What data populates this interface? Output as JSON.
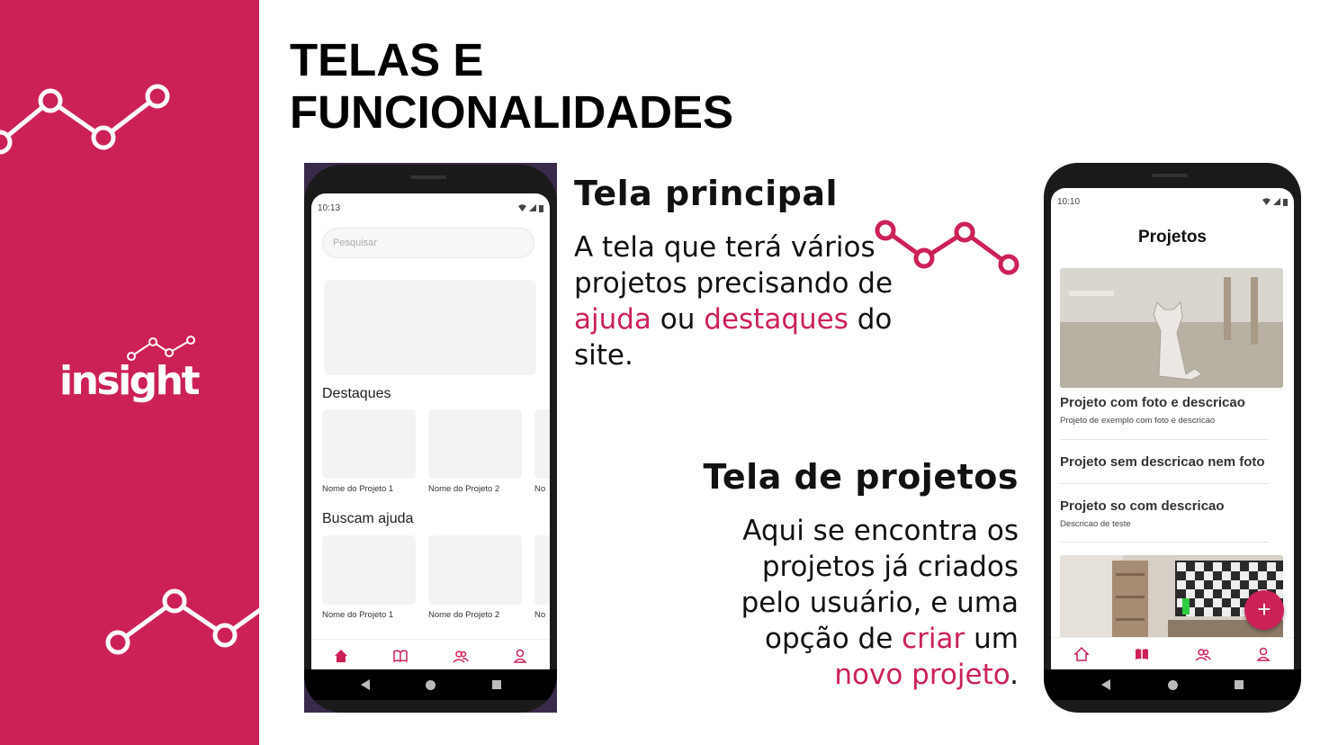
{
  "slide": {
    "title": "TELAS E FUNCIONALIDADES",
    "logo": "insight",
    "section1": {
      "heading": "Tela principal",
      "text_a": "A tela que terá vários projetos precisando de ",
      "highlight_a": "ajuda",
      "text_b": " ou ",
      "highlight_b": "destaques",
      "text_c": " do site."
    },
    "section2": {
      "heading": "Tela de projetos",
      "text_a": "Aqui se encontra os projetos já criados pelo usuário, e uma opção de ",
      "highlight_a": "criar",
      "text_b": " um ",
      "highlight_b": "novo projeto",
      "text_c": "."
    }
  },
  "colors": {
    "accent": "#cc2157",
    "background": "#ffffff",
    "text": "#111111"
  },
  "phone_main": {
    "status_time": "10:13",
    "search_placeholder": "Pesquisar",
    "destaques_title": "Destaques",
    "buscam_title": "Buscam ajuda",
    "card_1": "Nome do Projeto 1",
    "card_2": "Nome do Projeto 2",
    "card_3_partial": "No",
    "tabs": [
      "home-icon",
      "book-icon",
      "users-icon",
      "user-icon"
    ],
    "active_tab": "home-icon"
  },
  "phone_projects": {
    "status_time": "10:10",
    "header": "Projetos",
    "projects": [
      {
        "title": "Projeto com foto e descricao",
        "desc": "Projeto de exemplo com foto e descricao"
      },
      {
        "title": "Projeto sem descricao nem foto",
        "desc": ""
      },
      {
        "title": "Projeto so com descricao",
        "desc": "Descricao de teste"
      }
    ],
    "fab_label": "+",
    "tabs": [
      "home-icon",
      "book-icon",
      "users-icon",
      "user-icon"
    ],
    "active_tab": "book-icon"
  }
}
